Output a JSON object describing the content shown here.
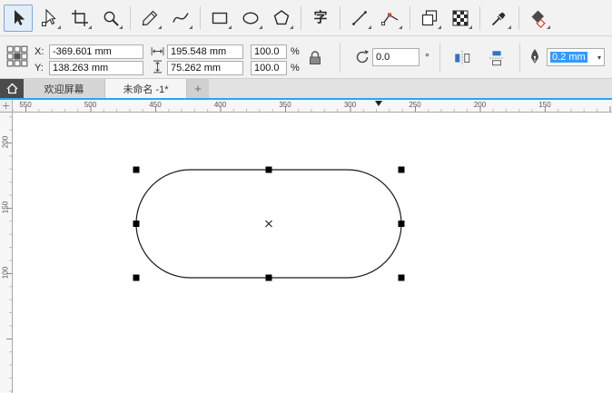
{
  "app": {
    "name": "CorelDRAW drawing window"
  },
  "toolbar": {
    "text_tool_glyph": "字",
    "tools": [
      {
        "id": "pick",
        "icon": "pick-arrow-icon",
        "selected": true
      },
      {
        "id": "shape",
        "icon": "shape-tool-icon"
      },
      {
        "id": "crop",
        "icon": "crop-icon"
      },
      {
        "id": "zoom",
        "icon": "zoom-magnifier-icon"
      },
      {
        "id": "freehand",
        "icon": "freehand-pencil-icon"
      },
      {
        "id": "bspline",
        "icon": "curve-squiggle-icon"
      },
      {
        "id": "rectangle",
        "icon": "rectangle-icon"
      },
      {
        "id": "ellipse",
        "icon": "ellipse-icon"
      },
      {
        "id": "polygon",
        "icon": "polygon-icon"
      },
      {
        "id": "text",
        "icon": "text-icon"
      },
      {
        "id": "line",
        "icon": "straight-line-icon"
      },
      {
        "id": "polyline",
        "icon": "polyline-nodes-icon"
      },
      {
        "id": "duplicate",
        "icon": "overlapping-squares-icon"
      },
      {
        "id": "transparency",
        "icon": "checkerboard-icon"
      },
      {
        "id": "eyedropper",
        "icon": "eyedropper-icon"
      },
      {
        "id": "fill",
        "icon": "interactive-fill-icon"
      }
    ]
  },
  "property_bar": {
    "icons": [
      "origin-grid-icon",
      "width-icon",
      "height-icon",
      "lock-ratio-icon",
      "rotate-icon",
      "mirror-horizontal-icon",
      "mirror-vertical-icon",
      "outline-pen-icon"
    ],
    "x_label": "X:",
    "x_value": "-369.601 mm",
    "y_label": "Y:",
    "y_value": "138.263 mm",
    "width_value": "195.548 mm",
    "height_value": "75.262 mm",
    "scale_x": "100.0",
    "scale_y": "100.0",
    "percent": "%",
    "rotation": "0.0",
    "degree_symbol": "°",
    "outline_width": "0.2 mm"
  },
  "tabs": {
    "welcome": "欢迎屏幕",
    "document": "未命名 -1*",
    "new_tab": "+"
  },
  "rulers": {
    "horizontal_labels": [
      "550",
      "500",
      "450",
      "400",
      "350",
      "300",
      "250",
      "200",
      "150"
    ],
    "vertical_labels": [
      "200",
      "150",
      "100"
    ]
  },
  "canvas": {
    "selected_object": {
      "type": "rounded-rectangle",
      "handle_count": 8,
      "center_marker": "×"
    }
  },
  "colors": {
    "selection_highlight": "#3399ff",
    "accent_line": "#2aa7e8",
    "handle": "#000000",
    "mirror_icon_blue": "#2e75c8",
    "node_red": "#e05a2b",
    "fill_icon_red": "#d23b2b"
  }
}
